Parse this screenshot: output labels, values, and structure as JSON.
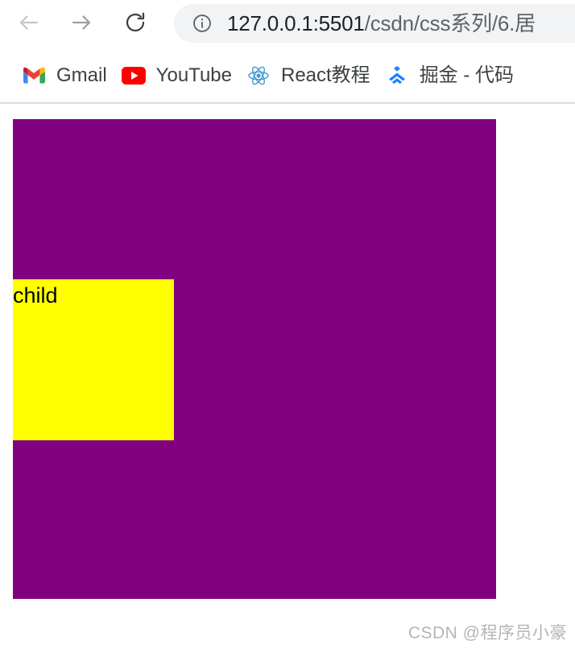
{
  "browser": {
    "toolbar": {
      "back_icon": "arrow-left-icon",
      "forward_icon": "arrow-right-icon",
      "reload_icon": "reload-icon",
      "site_info_icon": "info-circle-icon",
      "url_host": "127.0.0.1:5501",
      "url_path": "/csdn/css系列/6.居",
      "url_full": "127.0.0.1:5501/csdn/css系列/6.居"
    },
    "bookmarks": [
      {
        "label": "Gmail",
        "icon": "gmail-icon"
      },
      {
        "label": "YouTube",
        "icon": "youtube-icon"
      },
      {
        "label": "React教程",
        "icon": "react-icon"
      },
      {
        "label": "掘金 - 代码",
        "icon": "juejin-icon"
      }
    ]
  },
  "page": {
    "parent_box": {
      "color": "#800080",
      "label": ""
    },
    "child_box": {
      "color": "#ffff00",
      "label": "child"
    },
    "watermark": "CSDN @程序员小豪"
  }
}
